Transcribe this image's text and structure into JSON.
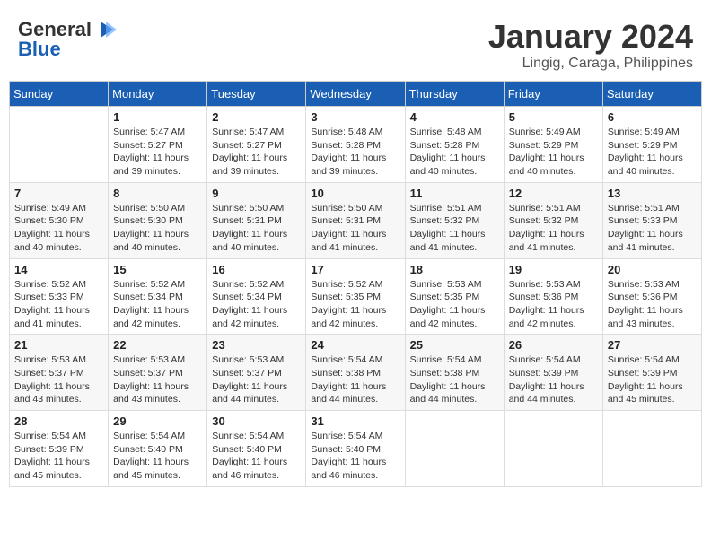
{
  "header": {
    "logo_general": "General",
    "logo_blue": "Blue",
    "month_title": "January 2024",
    "location": "Lingig, Caraga, Philippines"
  },
  "weekdays": [
    "Sunday",
    "Monday",
    "Tuesday",
    "Wednesday",
    "Thursday",
    "Friday",
    "Saturday"
  ],
  "weeks": [
    [
      {
        "day": "",
        "sunrise": "",
        "sunset": "",
        "daylight": ""
      },
      {
        "day": "1",
        "sunrise": "Sunrise: 5:47 AM",
        "sunset": "Sunset: 5:27 PM",
        "daylight": "Daylight: 11 hours and 39 minutes."
      },
      {
        "day": "2",
        "sunrise": "Sunrise: 5:47 AM",
        "sunset": "Sunset: 5:27 PM",
        "daylight": "Daylight: 11 hours and 39 minutes."
      },
      {
        "day": "3",
        "sunrise": "Sunrise: 5:48 AM",
        "sunset": "Sunset: 5:28 PM",
        "daylight": "Daylight: 11 hours and 39 minutes."
      },
      {
        "day": "4",
        "sunrise": "Sunrise: 5:48 AM",
        "sunset": "Sunset: 5:28 PM",
        "daylight": "Daylight: 11 hours and 40 minutes."
      },
      {
        "day": "5",
        "sunrise": "Sunrise: 5:49 AM",
        "sunset": "Sunset: 5:29 PM",
        "daylight": "Daylight: 11 hours and 40 minutes."
      },
      {
        "day": "6",
        "sunrise": "Sunrise: 5:49 AM",
        "sunset": "Sunset: 5:29 PM",
        "daylight": "Daylight: 11 hours and 40 minutes."
      }
    ],
    [
      {
        "day": "7",
        "sunrise": "Sunrise: 5:49 AM",
        "sunset": "Sunset: 5:30 PM",
        "daylight": "Daylight: 11 hours and 40 minutes."
      },
      {
        "day": "8",
        "sunrise": "Sunrise: 5:50 AM",
        "sunset": "Sunset: 5:30 PM",
        "daylight": "Daylight: 11 hours and 40 minutes."
      },
      {
        "day": "9",
        "sunrise": "Sunrise: 5:50 AM",
        "sunset": "Sunset: 5:31 PM",
        "daylight": "Daylight: 11 hours and 40 minutes."
      },
      {
        "day": "10",
        "sunrise": "Sunrise: 5:50 AM",
        "sunset": "Sunset: 5:31 PM",
        "daylight": "Daylight: 11 hours and 41 minutes."
      },
      {
        "day": "11",
        "sunrise": "Sunrise: 5:51 AM",
        "sunset": "Sunset: 5:32 PM",
        "daylight": "Daylight: 11 hours and 41 minutes."
      },
      {
        "day": "12",
        "sunrise": "Sunrise: 5:51 AM",
        "sunset": "Sunset: 5:32 PM",
        "daylight": "Daylight: 11 hours and 41 minutes."
      },
      {
        "day": "13",
        "sunrise": "Sunrise: 5:51 AM",
        "sunset": "Sunset: 5:33 PM",
        "daylight": "Daylight: 11 hours and 41 minutes."
      }
    ],
    [
      {
        "day": "14",
        "sunrise": "Sunrise: 5:52 AM",
        "sunset": "Sunset: 5:33 PM",
        "daylight": "Daylight: 11 hours and 41 minutes."
      },
      {
        "day": "15",
        "sunrise": "Sunrise: 5:52 AM",
        "sunset": "Sunset: 5:34 PM",
        "daylight": "Daylight: 11 hours and 42 minutes."
      },
      {
        "day": "16",
        "sunrise": "Sunrise: 5:52 AM",
        "sunset": "Sunset: 5:34 PM",
        "daylight": "Daylight: 11 hours and 42 minutes."
      },
      {
        "day": "17",
        "sunrise": "Sunrise: 5:52 AM",
        "sunset": "Sunset: 5:35 PM",
        "daylight": "Daylight: 11 hours and 42 minutes."
      },
      {
        "day": "18",
        "sunrise": "Sunrise: 5:53 AM",
        "sunset": "Sunset: 5:35 PM",
        "daylight": "Daylight: 11 hours and 42 minutes."
      },
      {
        "day": "19",
        "sunrise": "Sunrise: 5:53 AM",
        "sunset": "Sunset: 5:36 PM",
        "daylight": "Daylight: 11 hours and 42 minutes."
      },
      {
        "day": "20",
        "sunrise": "Sunrise: 5:53 AM",
        "sunset": "Sunset: 5:36 PM",
        "daylight": "Daylight: 11 hours and 43 minutes."
      }
    ],
    [
      {
        "day": "21",
        "sunrise": "Sunrise: 5:53 AM",
        "sunset": "Sunset: 5:37 PM",
        "daylight": "Daylight: 11 hours and 43 minutes."
      },
      {
        "day": "22",
        "sunrise": "Sunrise: 5:53 AM",
        "sunset": "Sunset: 5:37 PM",
        "daylight": "Daylight: 11 hours and 43 minutes."
      },
      {
        "day": "23",
        "sunrise": "Sunrise: 5:53 AM",
        "sunset": "Sunset: 5:37 PM",
        "daylight": "Daylight: 11 hours and 44 minutes."
      },
      {
        "day": "24",
        "sunrise": "Sunrise: 5:54 AM",
        "sunset": "Sunset: 5:38 PM",
        "daylight": "Daylight: 11 hours and 44 minutes."
      },
      {
        "day": "25",
        "sunrise": "Sunrise: 5:54 AM",
        "sunset": "Sunset: 5:38 PM",
        "daylight": "Daylight: 11 hours and 44 minutes."
      },
      {
        "day": "26",
        "sunrise": "Sunrise: 5:54 AM",
        "sunset": "Sunset: 5:39 PM",
        "daylight": "Daylight: 11 hours and 44 minutes."
      },
      {
        "day": "27",
        "sunrise": "Sunrise: 5:54 AM",
        "sunset": "Sunset: 5:39 PM",
        "daylight": "Daylight: 11 hours and 45 minutes."
      }
    ],
    [
      {
        "day": "28",
        "sunrise": "Sunrise: 5:54 AM",
        "sunset": "Sunset: 5:39 PM",
        "daylight": "Daylight: 11 hours and 45 minutes."
      },
      {
        "day": "29",
        "sunrise": "Sunrise: 5:54 AM",
        "sunset": "Sunset: 5:40 PM",
        "daylight": "Daylight: 11 hours and 45 minutes."
      },
      {
        "day": "30",
        "sunrise": "Sunrise: 5:54 AM",
        "sunset": "Sunset: 5:40 PM",
        "daylight": "Daylight: 11 hours and 46 minutes."
      },
      {
        "day": "31",
        "sunrise": "Sunrise: 5:54 AM",
        "sunset": "Sunset: 5:40 PM",
        "daylight": "Daylight: 11 hours and 46 minutes."
      },
      {
        "day": "",
        "sunrise": "",
        "sunset": "",
        "daylight": ""
      },
      {
        "day": "",
        "sunrise": "",
        "sunset": "",
        "daylight": ""
      },
      {
        "day": "",
        "sunrise": "",
        "sunset": "",
        "daylight": ""
      }
    ]
  ]
}
